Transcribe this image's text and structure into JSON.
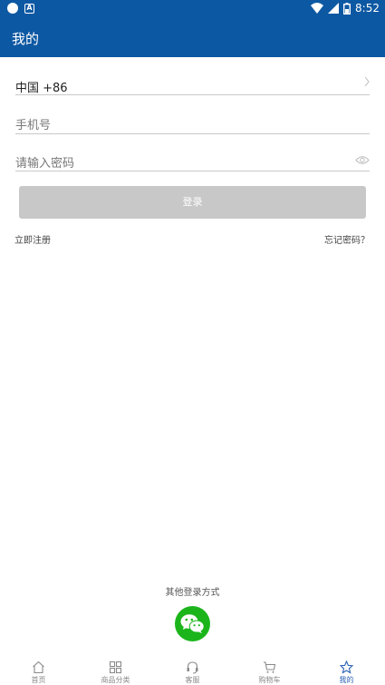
{
  "status_bar": {
    "time": "8:52",
    "icons": [
      "circle-icon",
      "notification-a-icon",
      "wifi-icon",
      "signal-icon",
      "battery-icon"
    ]
  },
  "app_bar": {
    "title": "我的"
  },
  "form": {
    "country_code": "中国 +86",
    "phone_placeholder": "手机号",
    "password_placeholder": "请输入密码",
    "login_label": "登录",
    "register_label": "立即注册",
    "forgot_label": "忘记密码？"
  },
  "other_login": {
    "label": "其他登录方式",
    "icon": "wechat-icon"
  },
  "tabs": [
    {
      "label": "首页",
      "icon": "home-icon",
      "active": false
    },
    {
      "label": "商品分类",
      "icon": "grid-icon",
      "active": false
    },
    {
      "label": "客服",
      "icon": "headset-icon",
      "active": false
    },
    {
      "label": "购物车",
      "icon": "cart-icon",
      "active": false
    },
    {
      "label": "我的",
      "icon": "star-icon",
      "active": true
    }
  ],
  "colors": {
    "primary": "#0d58a3",
    "active_tab": "#2b63b5",
    "wechat": "#1bb51b",
    "button_disabled": "#c8c8c8"
  }
}
